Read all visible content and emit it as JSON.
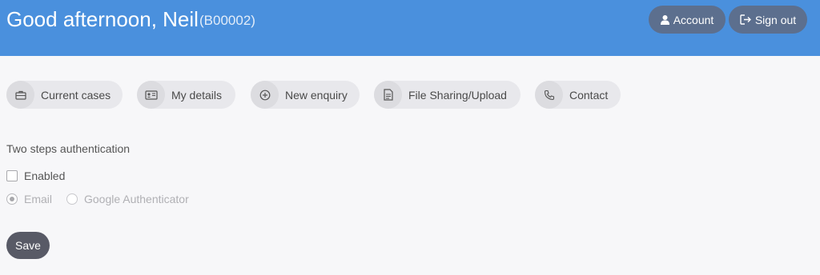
{
  "header": {
    "greeting": "Good afternoon, Neil",
    "user_id": "(B00002)",
    "account_label": "Account",
    "signout_label": "Sign out",
    "background": "#4a90dd"
  },
  "nav": [
    {
      "label": "Current cases",
      "icon": "briefcase-icon"
    },
    {
      "label": "My details",
      "icon": "id-card-icon"
    },
    {
      "label": "New enquiry",
      "icon": "plus-circle-icon"
    },
    {
      "label": "File Sharing/Upload",
      "icon": "document-icon"
    },
    {
      "label": "Contact",
      "icon": "phone-icon"
    }
  ],
  "two_factor": {
    "title": "Two steps authentication",
    "enabled_label": "Enabled",
    "enabled": false,
    "methods": [
      {
        "label": "Email",
        "selected": true
      },
      {
        "label": "Google Authenticator",
        "selected": false
      }
    ],
    "save_label": "Save"
  }
}
